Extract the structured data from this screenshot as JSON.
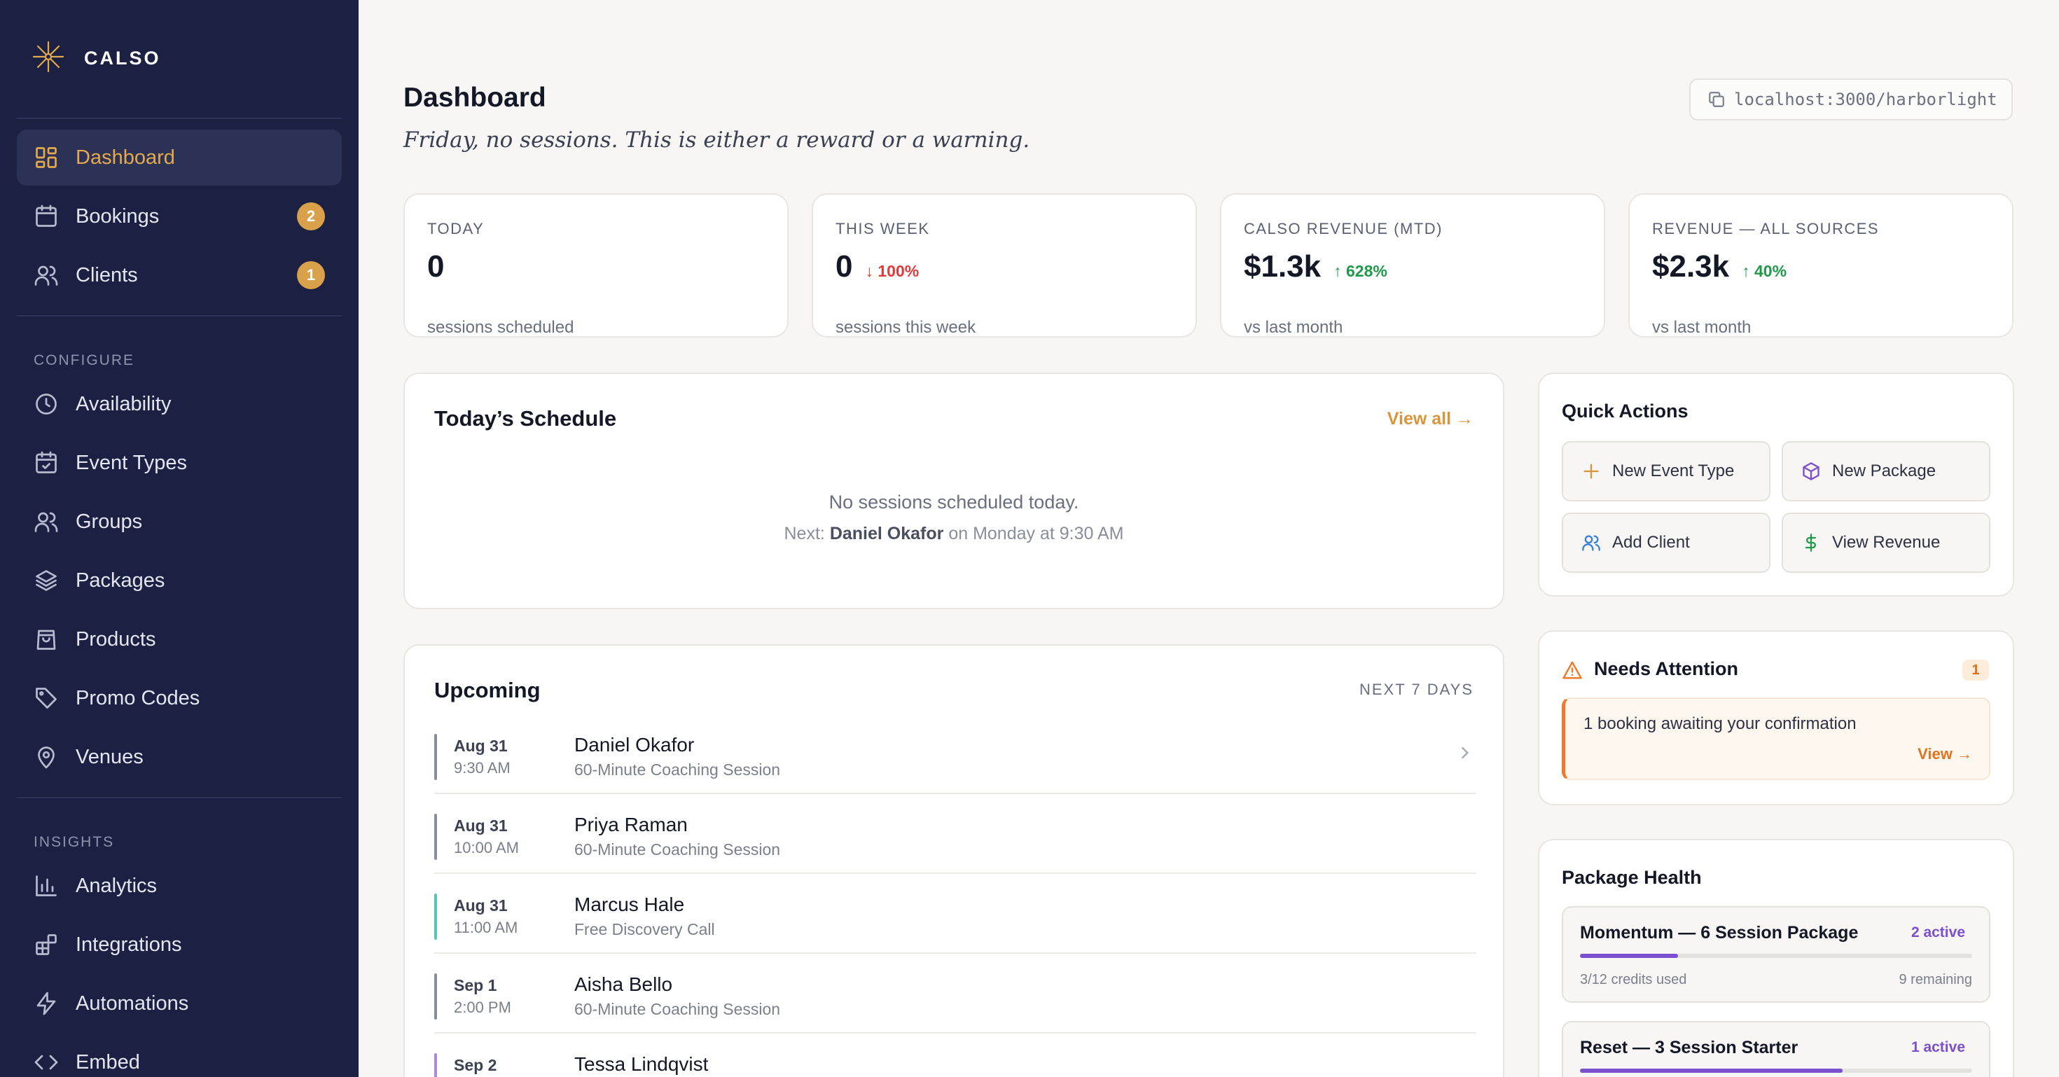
{
  "brand": {
    "name": "CALSO",
    "accent": "#e3a94c"
  },
  "sidebar": {
    "primary": [
      {
        "label": "Dashboard",
        "icon": "grid-icon",
        "active": true
      },
      {
        "label": "Bookings",
        "icon": "calendar-icon",
        "badge": "2"
      },
      {
        "label": "Clients",
        "icon": "users-icon",
        "badge": "1"
      }
    ],
    "configure_heading": "CONFIGURE",
    "configure": [
      {
        "label": "Availability",
        "icon": "clock-icon"
      },
      {
        "label": "Event Types",
        "icon": "calendar-check-icon"
      },
      {
        "label": "Groups",
        "icon": "users-icon"
      },
      {
        "label": "Packages",
        "icon": "layers-icon"
      },
      {
        "label": "Products",
        "icon": "shopping-bag-icon"
      },
      {
        "label": "Promo Codes",
        "icon": "tag-icon"
      },
      {
        "label": "Venues",
        "icon": "map-pin-icon"
      }
    ],
    "insights_heading": "INSIGHTS",
    "insights": [
      {
        "label": "Analytics",
        "icon": "bar-chart-icon"
      },
      {
        "label": "Integrations",
        "icon": "blocks-icon"
      },
      {
        "label": "Automations",
        "icon": "zap-icon"
      },
      {
        "label": "Embed",
        "icon": "code-icon"
      }
    ]
  },
  "header": {
    "title": "Dashboard",
    "subtitle": "Friday, no sessions. This is either a reward or a warning.",
    "url": "localhost:3000/harborlight"
  },
  "stats": [
    {
      "label": "TODAY",
      "value": "0",
      "delta": "",
      "caption": "sessions scheduled"
    },
    {
      "label": "THIS WEEK",
      "value": "0",
      "delta": "↓ 100%",
      "direction": "down",
      "caption": "sessions this week"
    },
    {
      "label": "CALSO REVENUE (MTD)",
      "value": "$1.3k",
      "delta": "↑ 628%",
      "direction": "up",
      "caption": "vs last month"
    },
    {
      "label": "REVENUE — ALL SOURCES",
      "value": "$2.3k",
      "delta": "↑ 40%",
      "direction": "up",
      "caption": "vs last month"
    }
  ],
  "schedule": {
    "title": "Today’s Schedule",
    "view_all": "View all →",
    "empty": "No sessions scheduled today.",
    "next_prefix": "Next:",
    "next_name": "Daniel Okafor",
    "next_suffix": "on Monday at 9:30 AM"
  },
  "upcoming": {
    "title": "Upcoming",
    "range": "NEXT 7 DAYS",
    "rows": [
      {
        "date": "Aug 31",
        "time": "9:30 AM",
        "name": "Daniel Okafor",
        "type": "60-Minute Coaching Session",
        "color": "#8a8c96"
      },
      {
        "date": "Aug 31",
        "time": "10:00 AM",
        "name": "Priya Raman",
        "type": "60-Minute Coaching Session",
        "color": "#8a8c96"
      },
      {
        "date": "Aug 31",
        "time": "11:00 AM",
        "name": "Marcus Hale",
        "type": "Free Discovery Call",
        "color": "#5cc4b4"
      },
      {
        "date": "Sep 1",
        "time": "2:00 PM",
        "name": "Aisha Bello",
        "type": "60-Minute Coaching Session",
        "color": "#8a8c96"
      },
      {
        "date": "Sep 2",
        "time": "",
        "name": "Tessa Lindqvist",
        "type": "",
        "color": "#a98ae0"
      }
    ]
  },
  "quick_actions": {
    "title": "Quick Actions",
    "items": [
      {
        "label": "New Event Type",
        "icon": "plus-icon",
        "color": "#d9953b"
      },
      {
        "label": "New Package",
        "icon": "package-icon",
        "color": "#7a4fd0"
      },
      {
        "label": "Add Client",
        "icon": "users-icon",
        "color": "#3b7fd9"
      },
      {
        "label": "View Revenue",
        "icon": "dollar-icon",
        "color": "#1f9a4a"
      }
    ]
  },
  "attention": {
    "title": "Needs Attention",
    "count": "1",
    "message": "1 booking awaiting your confirmation",
    "view": "View →"
  },
  "package_health": {
    "title": "Package Health",
    "packages": [
      {
        "name": "Momentum — 6 Session Package",
        "active": "2 active",
        "used": "3/12 credits used",
        "remaining": "9 remaining",
        "progress": 0.25
      },
      {
        "name": "Reset — 3 Session Starter",
        "active": "1 active",
        "used": "",
        "remaining": "",
        "progress": 0.67
      }
    ]
  }
}
